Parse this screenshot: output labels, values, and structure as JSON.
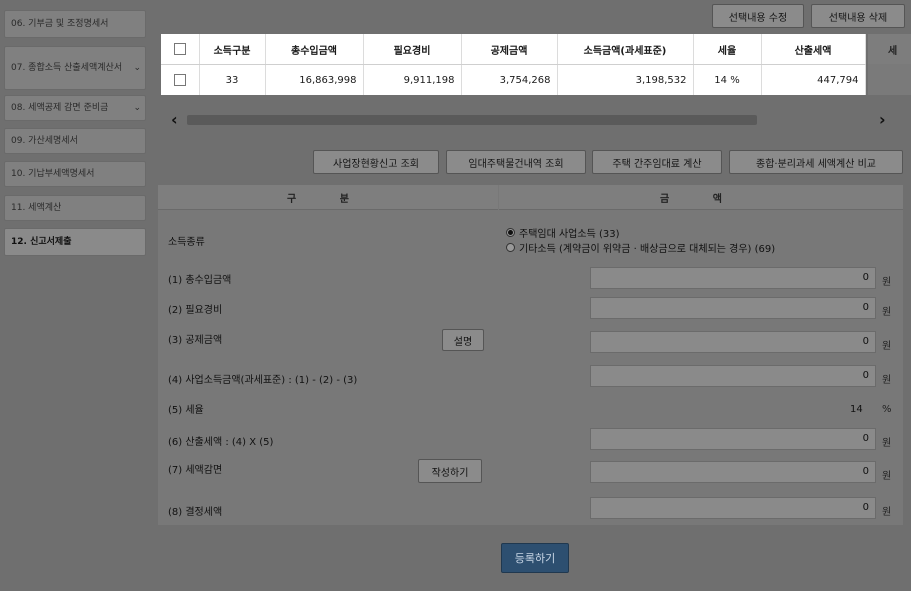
{
  "sidebar": {
    "items": [
      {
        "label": "06. 기부금 및 조정명세서",
        "expand": false
      },
      {
        "label": "07. 종합소득 산출세액계산서",
        "expand": true
      },
      {
        "label": "08. 세액공제 감면 준비금",
        "expand": true
      },
      {
        "label": "09. 가산세명세서",
        "expand": false
      },
      {
        "label": "10. 기납부세액명세서",
        "expand": false
      },
      {
        "label": "11. 세액계산",
        "expand": false
      },
      {
        "label": "12. 신고서제출",
        "expand": false
      }
    ]
  },
  "toolbar": {
    "edit_selected": "선택내용 수정",
    "delete_selected": "선택내용 삭제"
  },
  "table": {
    "headers": [
      "소득구분",
      "총수입금액",
      "필요경비",
      "공제금액",
      "소득금액(과세표준)",
      "세율",
      "산출세액",
      "세"
    ],
    "rows": [
      [
        "33",
        "16,863,998",
        "9,911,198",
        "3,754,268",
        "3,198,532",
        "14 %",
        "447,794"
      ]
    ]
  },
  "actions": {
    "business_report": "사업장현황신고 조회",
    "rental_housing": "임대주택물건내역 조회",
    "deemed_rent": "주택 간주임대료 계산",
    "tax_compare": "종합·분리과세 세액계산 비교"
  },
  "form": {
    "col_category": "구 분",
    "col_amount": "금 액",
    "income_type_label": "소득종류",
    "income_options": [
      {
        "label": "주택임대 사업소득 (33)",
        "selected": true
      },
      {
        "label": "기타소득 (계약금이 위약금 · 배상금으로 대체되는 경우) (69)",
        "selected": false
      }
    ],
    "rows": [
      {
        "label": "(1) 총수입금액",
        "value": "0",
        "unit": "원"
      },
      {
        "label": "(2) 필요경비",
        "value": "0",
        "unit": "원"
      },
      {
        "label": "(3) 공제금액",
        "value": "0",
        "unit": "원"
      },
      {
        "label": "(4) 사업소득금액(과세표준) : (1) - (2) - (3)",
        "value": "0",
        "unit": "원"
      },
      {
        "label": "(5) 세율",
        "value": "14",
        "unit": "%"
      },
      {
        "label": "(6) 산출세액 : (4) X (5)",
        "value": "0",
        "unit": "원"
      },
      {
        "label": "(7) 세액감면",
        "value": "0",
        "unit": "원"
      },
      {
        "label": "(8) 결정세액",
        "value": "0",
        "unit": "원"
      }
    ],
    "explain_button": "설명",
    "write_button": "작성하기"
  },
  "register_button": "등록하기"
}
